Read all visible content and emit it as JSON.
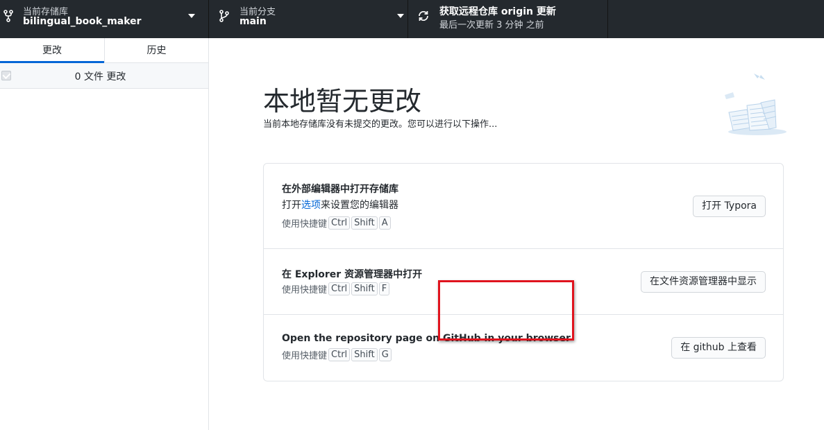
{
  "toolbar": {
    "repo": {
      "label": "当前存储库",
      "name": "bilingual_book_maker"
    },
    "branch": {
      "label": "当前分支",
      "name": "main"
    },
    "fetch": {
      "title": "获取远程仓库 origin 更新",
      "subtitle": "最后一次更新 3 分钟 之前"
    }
  },
  "sidebar": {
    "tabs": [
      {
        "label": "更改"
      },
      {
        "label": "历史"
      }
    ],
    "changes_count": "0 文件 更改"
  },
  "main": {
    "title": "本地暂无更改",
    "subtitle": "当前本地存储库没有未提交的更改。您可以进行以下操作...",
    "actions": [
      {
        "title": "在外部编辑器中打开存储库",
        "desc_prefix": "打开",
        "desc_link": "选项",
        "desc_suffix": "来设置您的编辑器",
        "shortcut_label": "使用快捷键",
        "keys": [
          "Ctrl",
          "Shift",
          "A"
        ],
        "button": "打开 Typora"
      },
      {
        "title": "在 Explorer 资源管理器中打开",
        "shortcut_label": "使用快捷键",
        "keys": [
          "Ctrl",
          "Shift",
          "F"
        ],
        "button": "在文件资源管理器中显示"
      },
      {
        "title": "Open the repository page on GitHub in your browser",
        "shortcut_label": "使用快捷键",
        "keys": [
          "Ctrl",
          "Shift",
          "G"
        ],
        "button": "在 github 上查看"
      }
    ]
  },
  "colors": {
    "toolbar_bg": "#24292e",
    "accent": "#0366d6",
    "highlight": "#e0141e"
  },
  "icons": [
    "repo-icon",
    "branch-icon",
    "sync-icon",
    "caret-down-icon",
    "checkbox-icon",
    "illustration-icon"
  ]
}
